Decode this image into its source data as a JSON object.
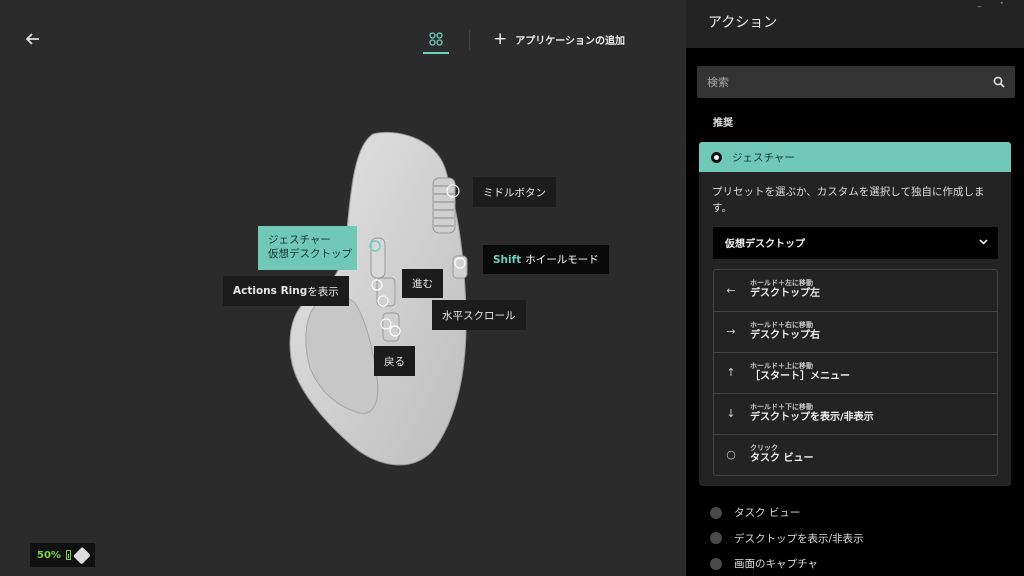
{
  "main": {
    "add_app_label": "アプリケーションの追加",
    "battery_level": "50%"
  },
  "mouse_labels": {
    "middle_button": "ミドルボタン",
    "gesture_title": "ジェスチャー",
    "gesture_sub": "仮想デスクトップ",
    "shift_keyword": "Shift",
    "shift_text": "ホイールモード",
    "actions_ring_bold": "Actions Ring",
    "actions_ring_rest": "を表示",
    "forward": "進む",
    "horizontal_scroll": "水平スクロール",
    "back": "戻る"
  },
  "panel": {
    "title": "アクション",
    "search_placeholder": "検索",
    "section_recommended": "推奨",
    "selected_action": "ジェスチャー",
    "description": "プリセットを選ぶか、カスタムを選択して独自に作成します。",
    "preset_value": "仮想デスクトップ",
    "gestures": [
      {
        "icon": "arrow-left-icon",
        "glyph": "←",
        "hint": "ホールド＋左に移動",
        "label": "デスクトップ左"
      },
      {
        "icon": "arrow-right-icon",
        "glyph": "→",
        "hint": "ホールド＋右に移動",
        "label": "デスクトップ右"
      },
      {
        "icon": "arrow-up-icon",
        "glyph": "↑",
        "hint": "ホールド＋上に移動",
        "label": "［スタート］メニュー"
      },
      {
        "icon": "arrow-down-icon",
        "glyph": "↓",
        "hint": "ホールド＋下に移動",
        "label": "デスクトップを表示/非表示"
      },
      {
        "icon": "circle-click-icon",
        "glyph": "○",
        "hint": "クリック",
        "label": "タスク ビュー"
      }
    ],
    "other_actions": [
      "タスク ビュー",
      "デスクトップを表示/非表示",
      "画面のキャプチャ"
    ]
  },
  "colors": {
    "accent": "#6fc9b6",
    "battery": "#7fd24c",
    "background": "#2b2b2b",
    "panel": "#000000"
  }
}
